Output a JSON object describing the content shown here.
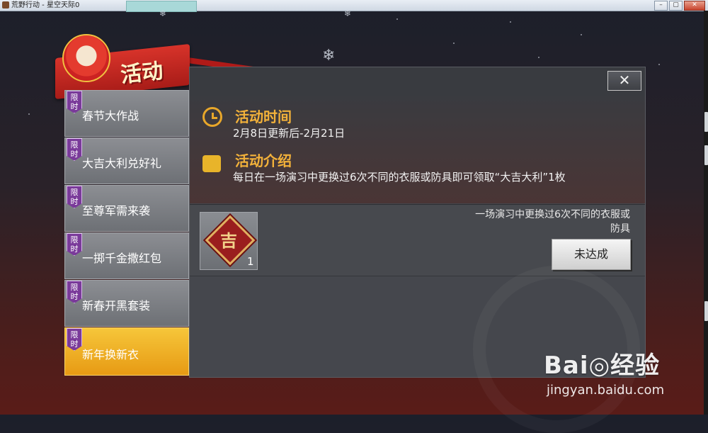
{
  "window": {
    "title": "荒野行动 - 星空天际0",
    "buttons": [
      "–",
      "▢",
      "✕"
    ]
  },
  "header": {
    "title": "活动"
  },
  "sidebar": {
    "items": [
      {
        "tag": "限时",
        "label": "春节大作战",
        "active": false
      },
      {
        "tag": "限时",
        "label": "大吉大利兑好礼",
        "active": false
      },
      {
        "tag": "限时",
        "label": "至尊军需来袭",
        "active": false
      },
      {
        "tag": "限时",
        "label": "一掷千金撒红包",
        "active": false
      },
      {
        "tag": "限时",
        "label": "新春开黑套装",
        "active": false
      },
      {
        "tag": "限时",
        "label": "新年换新衣",
        "active": true
      }
    ]
  },
  "panel": {
    "close": "✕",
    "time": {
      "title": "活动时间",
      "text": "2月8日更新后-2月21日"
    },
    "intro": {
      "title": "活动介绍",
      "text": "每日在一场演习中更换过6次不同的衣服或防具即可领取“大吉大利”1枚"
    },
    "task": {
      "reward_char": "吉",
      "reward_count": "1",
      "desc_line1": "一场演习中更换过6次不同的衣服或",
      "desc_line2": "防具",
      "status": "未达成"
    }
  },
  "watermark": {
    "brand": "Bai◎经验",
    "url": "jingyan.baidu.com"
  },
  "colors": {
    "accent": "#f3b23a",
    "active_tab": "#f0b028",
    "tag": "#7a3a9a"
  }
}
